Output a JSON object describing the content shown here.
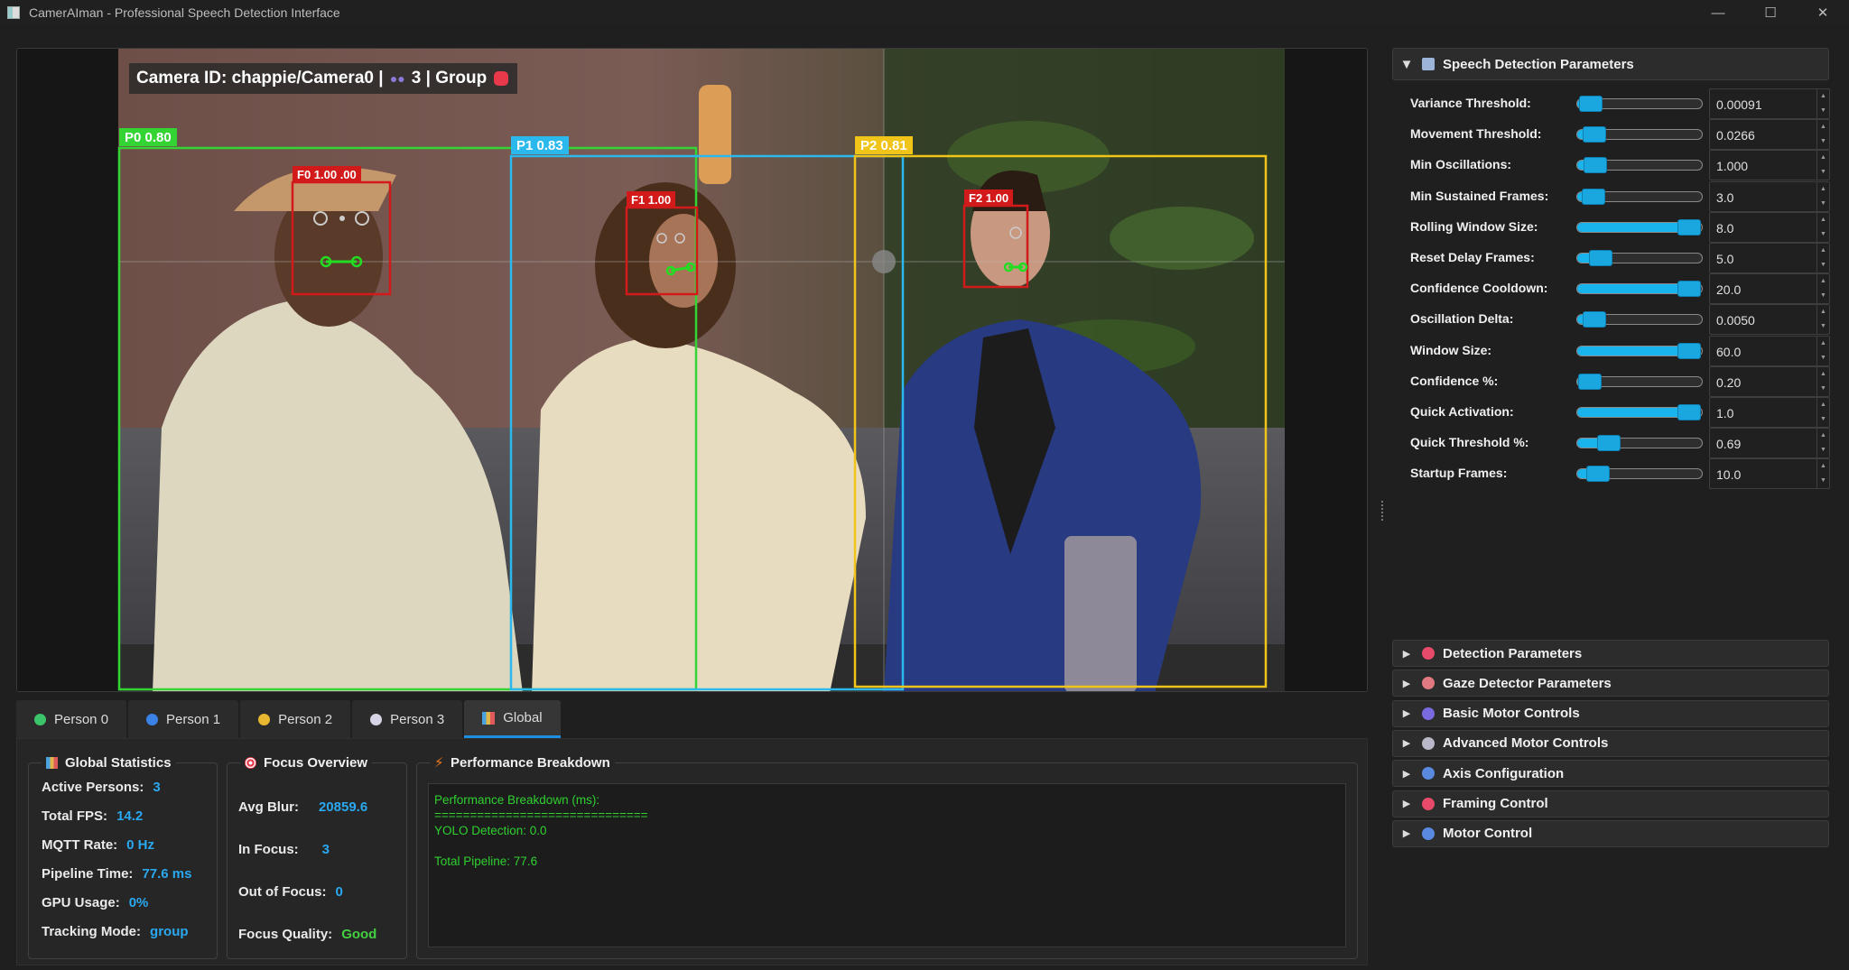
{
  "window": {
    "title": "CamerAIman - Professional Speech Detection Interface",
    "minimize": "—",
    "maximize": "☐",
    "close": "✕"
  },
  "video": {
    "camera_label_prefix": "Camera ID: chappie/Camera0 | ",
    "camera_label_count": "3",
    "camera_label_suffix": " | Group",
    "persons": [
      {
        "label": "P0 0.80",
        "color": "#35d435"
      },
      {
        "label": "P1 0.83",
        "color": "#2bb8ec"
      },
      {
        "label": "P2 0.81",
        "color": "#f0c419"
      }
    ],
    "faces": [
      {
        "label": "F0 1.00 .00",
        "color": "#d21a1a"
      },
      {
        "label": "F1 1.00",
        "color": "#d21a1a"
      },
      {
        "label": "F2 1.00",
        "color": "#d21a1a"
      }
    ]
  },
  "tabs": [
    {
      "label": "Person 0",
      "dot": "#3cc46a"
    },
    {
      "label": "Person 1",
      "dot": "#3b82e6"
    },
    {
      "label": "Person 2",
      "dot": "#e8b830"
    },
    {
      "label": "Person 3",
      "dot": "#d8d4e8"
    },
    {
      "label": "Global",
      "icon": "bar-chart-icon",
      "active": true
    }
  ],
  "global_stats": {
    "title": "Global Statistics",
    "rows": [
      {
        "label": "Active Persons:",
        "value": "3"
      },
      {
        "label": "Total FPS:",
        "value": "14.2"
      },
      {
        "label": "MQTT Rate:",
        "value": "0 Hz"
      },
      {
        "label": "Pipeline Time:",
        "value": "77.6 ms"
      },
      {
        "label": "GPU Usage:",
        "value": "0%"
      },
      {
        "label": "Tracking Mode:",
        "value": "group"
      }
    ]
  },
  "focus_overview": {
    "title": "Focus Overview",
    "rows": [
      {
        "label": "Avg Blur:",
        "value": "20859.6"
      },
      {
        "label": "In Focus:",
        "value": "3"
      },
      {
        "label": "Out of Focus:",
        "value": "0"
      },
      {
        "label": "Focus Quality:",
        "value": "Good"
      }
    ]
  },
  "performance": {
    "title": "Performance Breakdown",
    "lines": [
      "Performance Breakdown (ms):",
      "==============================",
      "YOLO Detection: 0.0",
      "",
      "Total Pipeline: 77.6"
    ]
  },
  "speech_params": {
    "title": "Speech Detection Parameters",
    "params": [
      {
        "label": "Variance Threshold:",
        "value": "0.00091",
        "level": 0.03
      },
      {
        "label": "Movement Threshold:",
        "value": "0.0266",
        "level": 0.06
      },
      {
        "label": "Min Oscillations:",
        "value": "1.000",
        "level": 0.07
      },
      {
        "label": "Min Sustained Frames:",
        "value": "3.0",
        "level": 0.05
      },
      {
        "label": "Rolling Window Size:",
        "value": "8.0",
        "level": 0.98
      },
      {
        "label": "Reset Delay Frames:",
        "value": "5.0",
        "level": 0.12
      },
      {
        "label": "Confidence Cooldown:",
        "value": "20.0",
        "level": 0.98
      },
      {
        "label": "Oscillation Delta:",
        "value": "0.0050",
        "level": 0.06
      },
      {
        "label": "Window Size:",
        "value": "60.0",
        "level": 0.98
      },
      {
        "label": "Confidence %:",
        "value": "0.20",
        "level": 0.02
      },
      {
        "label": "Quick Activation:",
        "value": "1.0",
        "level": 0.98
      },
      {
        "label": "Quick Threshold %:",
        "value": "0.69",
        "level": 0.2
      },
      {
        "label": "Startup Frames:",
        "value": "10.0",
        "level": 0.1
      }
    ]
  },
  "collapsed_sections": [
    {
      "label": "Detection Parameters",
      "icon_color": "#e84a6a"
    },
    {
      "label": "Gaze Detector Parameters",
      "icon_color": "#e07a80"
    },
    {
      "label": "Basic Motor Controls",
      "icon_color": "#7a6adf"
    },
    {
      "label": "Advanced Motor Controls",
      "icon_color": "#b8b8c8"
    },
    {
      "label": "Axis Configuration",
      "icon_color": "#5a8ae0"
    },
    {
      "label": "Framing Control",
      "icon_color": "#e84a6a"
    },
    {
      "label": "Motor Control",
      "icon_color": "#5a8ae0"
    }
  ]
}
